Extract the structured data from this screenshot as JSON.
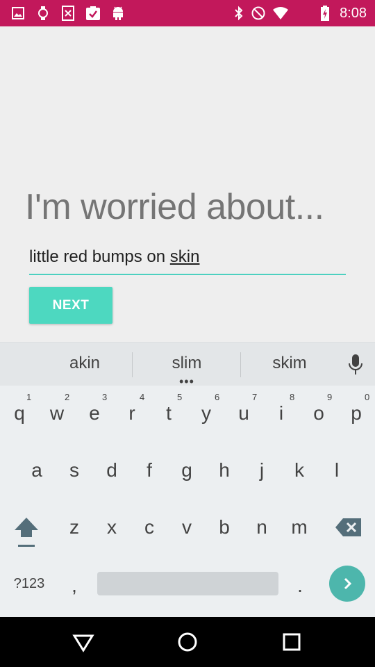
{
  "status_bar": {
    "time": "8:08",
    "left_icons": [
      "image-icon",
      "watch-icon",
      "close-box-icon",
      "clipboard-check-icon",
      "android-icon"
    ],
    "right_icons": [
      "bluetooth-icon",
      "do-not-disturb-icon",
      "wifi-icon",
      "battery-icon"
    ],
    "color": "#c2185b"
  },
  "main": {
    "headline": "I'm worried about...",
    "input": {
      "value_prefix": "little red bumps on ",
      "value_word": "skin"
    },
    "next_label": "NEXT",
    "accent": "#4dd8c0"
  },
  "keyboard": {
    "suggestions": [
      "akin",
      "slim",
      "skim"
    ],
    "suggestion_more": "•••",
    "row1": [
      {
        "key": "q",
        "hint": "1"
      },
      {
        "key": "w",
        "hint": "2"
      },
      {
        "key": "e",
        "hint": "3"
      },
      {
        "key": "r",
        "hint": "4"
      },
      {
        "key": "t",
        "hint": "5"
      },
      {
        "key": "y",
        "hint": "6"
      },
      {
        "key": "u",
        "hint": "7"
      },
      {
        "key": "i",
        "hint": "8"
      },
      {
        "key": "o",
        "hint": "9"
      },
      {
        "key": "p",
        "hint": "0"
      }
    ],
    "row2": [
      "a",
      "s",
      "d",
      "f",
      "g",
      "h",
      "j",
      "k",
      "l"
    ],
    "row3": [
      "z",
      "x",
      "c",
      "v",
      "b",
      "n",
      "m"
    ],
    "symbols_label": "?123",
    "comma": ",",
    "period": "."
  }
}
